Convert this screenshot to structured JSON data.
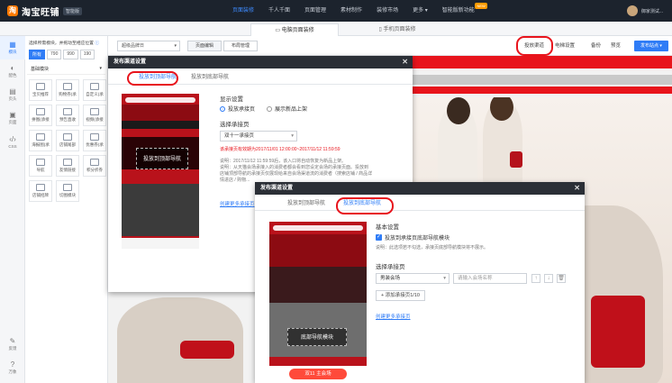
{
  "topbar": {
    "logo_text": "淘宝旺铺",
    "logo_badge": "智能版",
    "nav": [
      {
        "label": "页面装修",
        "active": true
      },
      {
        "label": "千人千面",
        "active": false
      },
      {
        "label": "页面管理",
        "active": false
      },
      {
        "label": "素材制作",
        "active": false
      },
      {
        "label": "装修市场",
        "active": false
      },
      {
        "label": "更多",
        "active": false
      },
      {
        "label": "智能版新功能",
        "active": false,
        "badge": "NEW"
      }
    ],
    "username": "御家测试...",
    "accent_color": "#3e8bff"
  },
  "page_tabs": [
    {
      "label": "电脑页面装修",
      "active": true
    },
    {
      "label": "手机页面装修",
      "active": false
    }
  ],
  "left_rail": {
    "items": [
      {
        "label": "模块",
        "icon": "grid-icon",
        "active": true
      },
      {
        "label": "配色",
        "icon": "palette-icon",
        "active": false
      },
      {
        "label": "页头",
        "icon": "header-icon",
        "active": false
      },
      {
        "label": "页面",
        "icon": "page-icon",
        "active": false
      },
      {
        "label": "CSS",
        "icon": "code-icon",
        "active": false
      }
    ],
    "bottom_items": [
      {
        "label": "反馈",
        "icon": "feedback-icon"
      },
      {
        "label": "万象",
        "icon": "help-icon"
      }
    ]
  },
  "module_panel": {
    "hint": "选择所需模块，并拖动至相应位置",
    "width_options": [
      {
        "label": "所有",
        "active": true
      },
      {
        "label": "790",
        "active": false
      },
      {
        "label": "990",
        "active": false
      },
      {
        "label": "190",
        "active": false
      }
    ],
    "section_title": "基础模块",
    "modules": [
      {
        "label": "宝贝推荐"
      },
      {
        "label": "购物券(承"
      },
      {
        "label": "自定义(承"
      },
      {
        "label": "拼图(承接"
      },
      {
        "label": "预告直收"
      },
      {
        "label": "视频(承接"
      },
      {
        "label": "海报图(承"
      },
      {
        "label": "店铺尾部"
      },
      {
        "label": "优惠券(承"
      },
      {
        "label": "导航"
      },
      {
        "label": "友情链接"
      },
      {
        "label": "积分折券"
      },
      {
        "label": "店铺招牌"
      },
      {
        "label": "切图模块"
      }
    ]
  },
  "toolbar": {
    "page_select": "超级品牌日",
    "page_edit_button": "页面编辑",
    "layout_manage_button": "布局管理",
    "publish_channel": "投放渠道",
    "ecard": "电梯设置",
    "backup": "备份",
    "preview": "预览",
    "publish_site": "发布站点"
  },
  "modal_top": {
    "title": "发布渠道设置",
    "tabs": [
      {
        "label": "投放到顶部导航",
        "active": true
      },
      {
        "label": "投放到底部导航",
        "active": false
      }
    ],
    "display_title": "显示设置",
    "radio_a": "投放承接页",
    "radio_b": "展示新品上架",
    "select_label": "选择承接页",
    "select_value": "双十一承接页",
    "red_note": "该承接页有效期为2017/11/01 12:00:00~2017/11/12 11:59:59",
    "note_lines": [
      "说明：2017/11/12 11:59:59后，该入口将自动恢复为新品上架。",
      "说明：从天猫会场承接入的消费者都会看到您设定会场的承接页面。投放到",
      "店铺顶部导航的承接页仅展现给来自会场渠道流的消费者（搜索店铺 / 商品详",
      "情进店 / 购物..."
    ],
    "create_link": "创建更多承接页",
    "phone_overlay": "投放到顶部导航"
  },
  "modal_bottom": {
    "title": "发布渠道设置",
    "tabs": [
      {
        "label": "投放到顶部导航",
        "active": false
      },
      {
        "label": "投放到底部导航",
        "active": true
      }
    ],
    "basic_title": "基本设置",
    "checkbox_label": "投放到承接页底部导航模块",
    "note": "说明：此选项若不勾选，承接页底部导航模块将不展示。",
    "select_label": "选择承接页",
    "select_value": "男装会场",
    "input_placeholder": "请输入会场名称",
    "add_button": "+ 添加承接页1/10",
    "create_link": "创建更多承接页",
    "phone_overlay": "底部导航模块",
    "phone_footer": "双11 主会场"
  }
}
